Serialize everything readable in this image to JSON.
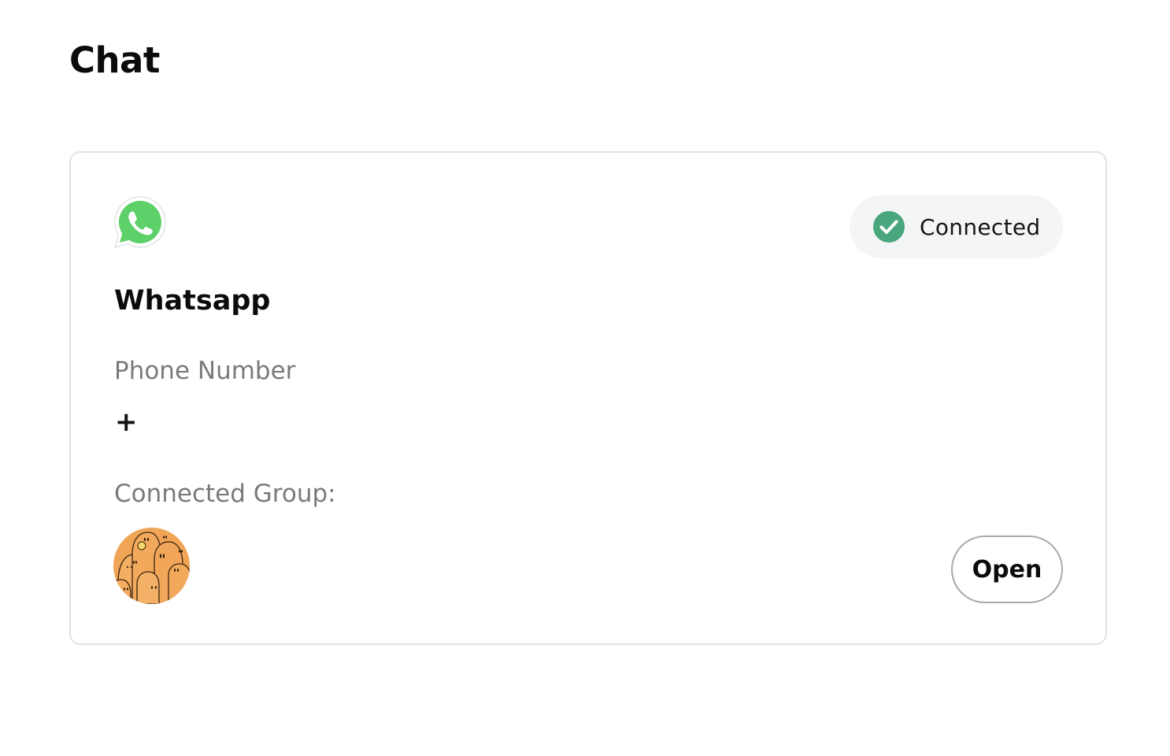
{
  "page": {
    "title": "Chat"
  },
  "integration": {
    "name": "Whatsapp",
    "logo_icon": "whatsapp-icon",
    "status": {
      "label": "Connected",
      "icon": "check-circle-icon",
      "color": "#4aa67c"
    },
    "phone": {
      "label": "Phone Number",
      "value": "+"
    },
    "group": {
      "label": "Connected Group:",
      "avatar_icon": "group-avatar"
    },
    "open_label": "Open"
  },
  "colors": {
    "whatsapp_green": "#5ed06a",
    "badge_background": "#f4f5f7",
    "avatar_orange": "#f0a455"
  }
}
